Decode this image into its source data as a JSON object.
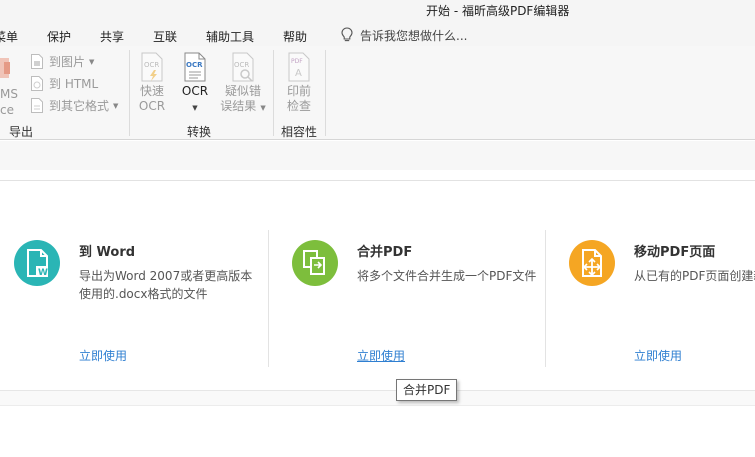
{
  "window": {
    "title": "开始 - 福昕高级PDF编辑器"
  },
  "menu": {
    "items": [
      "菜单",
      "保护",
      "共享",
      "互联",
      "辅助工具",
      "帮助"
    ],
    "tellme_placeholder": "告诉我您想做什么..."
  },
  "ribbon": {
    "export_group": {
      "label": "导出",
      "left_cut_top": "MS",
      "left_cut_bottom": "ce",
      "buttons": [
        "到图片",
        "到 HTML",
        "到其它格式"
      ]
    },
    "convert_group": {
      "label": "转换",
      "quick_ocr": [
        "快速",
        "OCR"
      ],
      "ocr": "OCR",
      "suspect": [
        "疑似错",
        "误结果"
      ]
    },
    "compat_group": {
      "label": "相容性",
      "preflight": [
        "印前",
        "检查"
      ]
    }
  },
  "cards": [
    {
      "title": "到 Word",
      "desc": "导出为Word 2007或者更高版本使用的.docx格式的文件",
      "link": "立即使用",
      "icon": "word-document-icon",
      "color": "#2ab5b5"
    },
    {
      "title": "合并PDF",
      "desc": "将多个文件合并生成一个PDF文件",
      "link": "立即使用",
      "icon": "merge-pdf-icon",
      "color": "#7dbe3c"
    },
    {
      "title": "移动PDF页面",
      "desc": "从已有的PDF页面创建新",
      "link": "立即使用",
      "icon": "move-page-icon",
      "color": "#f5a623"
    }
  ],
  "tooltip": {
    "text": "合并PDF"
  }
}
